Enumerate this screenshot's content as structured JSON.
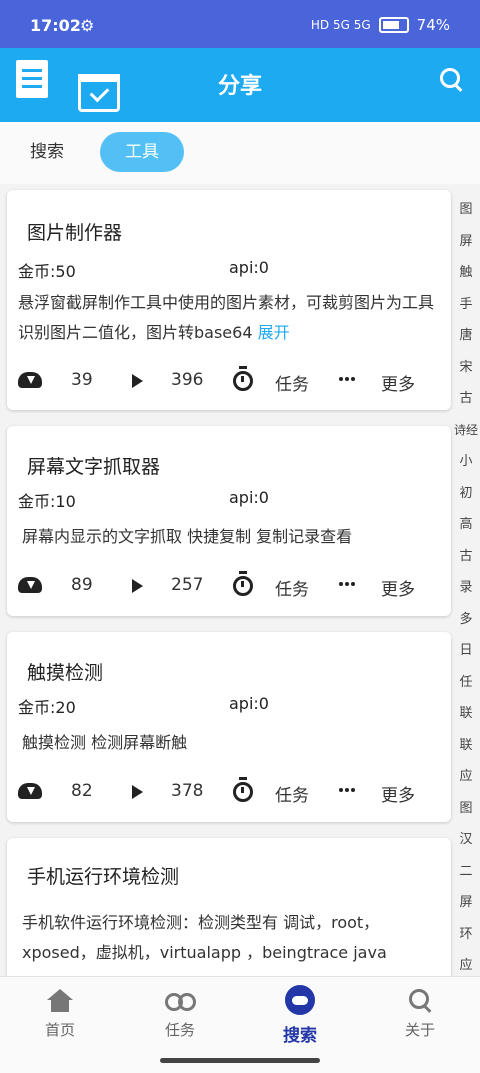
{
  "status_bar": {
    "time": "17:02",
    "signal_text": "HD 5G 5G",
    "battery": "74%"
  },
  "top_bar": {
    "title": "分享"
  },
  "tabs": [
    {
      "label": "搜索"
    },
    {
      "label": "工具"
    }
  ],
  "cards": [
    {
      "name": "图片制作器",
      "coins": "金币:50",
      "api": "api:0",
      "desc": "悬浮窗截屏制作工具中使用的图片素材，可裁剪图片为工具识别图片二值化，图片转base64",
      "expand": "展开",
      "downloads": "39",
      "plays": "396",
      "task_label": "任务",
      "more_label": "更多"
    },
    {
      "name": "屏幕文字抓取器",
      "coins": "金币:10",
      "api": "api:0",
      "desc": "屏幕内显示的文字抓取 快捷复制 复制记录查看",
      "downloads": "89",
      "plays": "257",
      "task_label": "任务",
      "more_label": "更多"
    },
    {
      "name": "触摸检测",
      "coins": "金币:20",
      "api": "api:0",
      "desc": "触摸检测 检测屏幕断触",
      "downloads": "82",
      "plays": "378",
      "task_label": "任务",
      "more_label": "更多"
    },
    {
      "name": "手机运行环境检测",
      "desc": "手机软件运行环境检测：检测类型有 调试，root，xposed，虚拟机，virtualapp ，beingtrace java"
    }
  ],
  "index_sidebar": [
    "图",
    "屏",
    "触",
    "手",
    "唐",
    "宋",
    "古",
    "诗经",
    "小",
    "初",
    "高",
    "古",
    "录",
    "多",
    "日",
    "任",
    "联",
    "联",
    "应",
    "图",
    "汉",
    "二",
    "屏",
    "环",
    "应"
  ],
  "bottom_nav": [
    {
      "label": "首页",
      "icon": "home-icon"
    },
    {
      "label": "任务",
      "icon": "infinity-icon"
    },
    {
      "label": "搜索",
      "icon": "cloud-icon",
      "active": true
    },
    {
      "label": "关于",
      "icon": "search-icon"
    }
  ],
  "colors": {
    "status_bar": "#4a64da",
    "top_bar": "#1eaaf1",
    "active_tab": "#52c0f5",
    "nav_active": "#2437a8"
  }
}
